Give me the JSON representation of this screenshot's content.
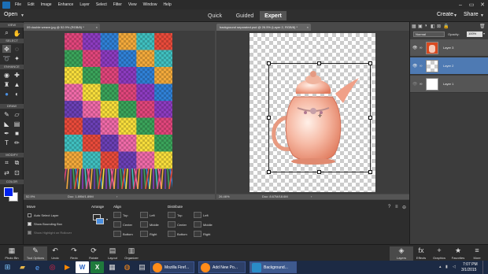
{
  "menu": {
    "items": [
      "File",
      "Edit",
      "Image",
      "Enhance",
      "Layer",
      "Select",
      "Filter",
      "View",
      "Window",
      "Help"
    ]
  },
  "modes": {
    "open_label": "Open",
    "tabs": [
      "Quick",
      "Guided",
      "Expert"
    ],
    "active": "Expert",
    "create_label": "Create",
    "share_label": "Share"
  },
  "toolbox": {
    "sections": [
      "VIEW",
      "SELECT",
      "ENHANCE",
      "DRAW",
      "MODIFY",
      "COLOR"
    ],
    "foreground_color": "#0022ee",
    "background_color": "#ffffff"
  },
  "documents": [
    {
      "tab": "09 double weave.jpg @ 52.9% (RGB/8) *",
      "zoom": "52.9%",
      "doc": "Doc: 1.89M/1.89M"
    },
    {
      "tab": "background separated.psd @ 26.5% (Layer 2, RGB/8) *",
      "zoom": "26.46%",
      "doc": "Doc: 8.67M/18.6M"
    }
  ],
  "layers_panel": {
    "blend_mode": "Normal",
    "opacity_label": "Opacity:",
    "opacity_value": "100%",
    "layers": [
      {
        "name": "Layer 3",
        "selected": false,
        "thumb": "teapot-red"
      },
      {
        "name": "Layer 2",
        "selected": true,
        "thumb": "transparent"
      },
      {
        "name": "Layer 1",
        "selected": false,
        "thumb": "white"
      }
    ]
  },
  "options": {
    "move_label": "Move",
    "auto_select": "Auto Select Layer",
    "show_bbox": "Show Bounding Box",
    "show_highlight": "Show Highlight on Rollover",
    "arrange_label": "Arrange",
    "align_label": "Align",
    "align": [
      "Top",
      "Center",
      "Bottom",
      "Left",
      "Middle",
      "Right"
    ],
    "distribute_label": "Distribute",
    "distribute": [
      "Top",
      "Center",
      "Bottom",
      "Left",
      "Middle",
      "Right"
    ]
  },
  "bottom_bar": {
    "left": [
      "Photo Bin",
      "Tool Options",
      "Undo",
      "Redo",
      "Rotate",
      "Layout",
      "Organizer"
    ],
    "right": [
      "Layers",
      "Effects",
      "Graphics",
      "Favorites",
      "More"
    ]
  },
  "taskbar": {
    "windows": [
      "Mozilla Firef...",
      "Add New Po...",
      "Background..."
    ],
    "time": "7:07 PM",
    "date": "3/1/2015"
  }
}
